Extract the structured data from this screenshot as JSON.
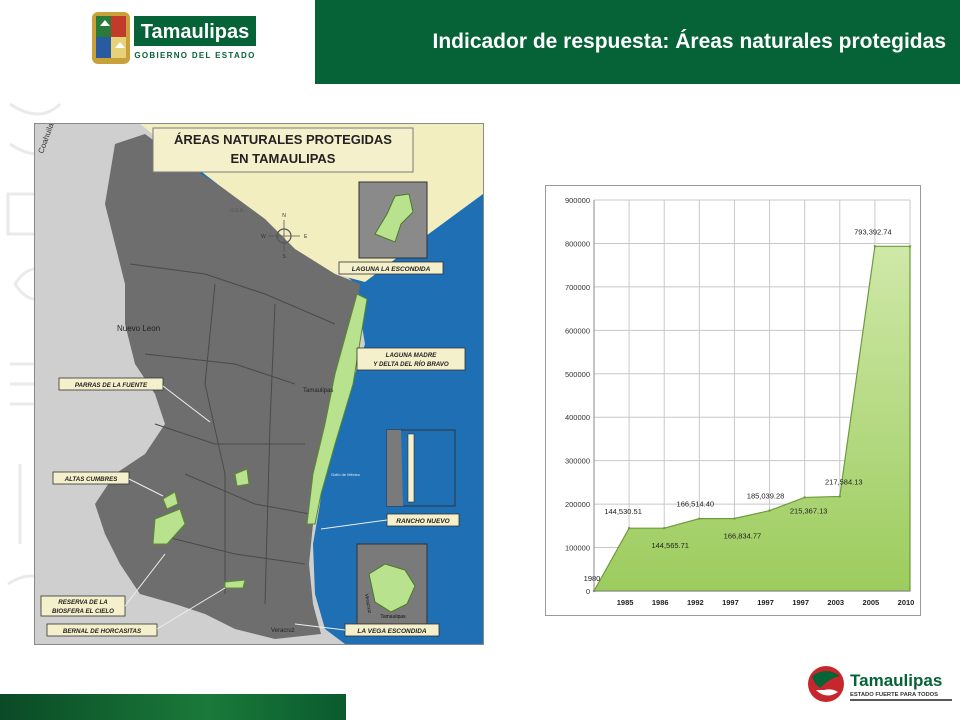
{
  "header": {
    "logo_name": "Tamaulipas",
    "logo_subtitle": "GOBIERNO DEL ESTADO",
    "title": "Indicador de respuesta: Áreas naturales protegidas"
  },
  "map": {
    "title_line1": "ÁREAS NATURALES PROTEGIDAS",
    "title_line2": "EN TAMAULIPAS",
    "labels": {
      "coahuila": "Coahuila",
      "usa": "U.S.A.",
      "nuevo_leon": "Nuevo Leon",
      "tamaulipas": "Tamaulipas",
      "golfo": "Golfo de México",
      "veracruz": "Veracruz",
      "compass_n": "N",
      "compass_s": "S",
      "compass_e": "E",
      "compass_w": "W",
      "inset_tamaulipas": "Tamaulipas",
      "inset_veracruz": "Veracruz"
    },
    "areas": {
      "laguna_escondida": "LAGUNA LA ESCONDIDA",
      "laguna_madre_1": "LAGUNA MADRE",
      "laguna_madre_2": "Y DELTA DEL RÍO BRAVO",
      "parras": "PARRAS DE LA FUENTE",
      "altas_cumbres": "ALTAS CUMBRES",
      "rancho_nuevo": "RANCHO NUEVO",
      "reserva_1": "RESERVA DE LA",
      "reserva_2": "BIOSFERA EL CIELO",
      "bernal": "BERNAL DE HORCASITAS",
      "vega": "LA VEGA ESCONDIDA"
    },
    "colors": {
      "sea": "#1e6fb3",
      "land": "#6e6e6e",
      "usa": "#f3eec0",
      "protected": "#b9e28f"
    }
  },
  "chart_data": {
    "type": "area",
    "categories": [
      "1980",
      "1985",
      "1986",
      "1992",
      "1997",
      "1997",
      "1997",
      "2003",
      "2005",
      "2010"
    ],
    "x_tick_labels": [
      "1985",
      "1986",
      "1992",
      "1997",
      "1997",
      "1997",
      "2003",
      "2005",
      "2010"
    ],
    "values": [
      0,
      144530.51,
      144565.71,
      166514.4,
      166834.77,
      185039.28,
      215367.13,
      217584.13,
      793392.74,
      793392.74
    ],
    "data_labels": [
      {
        "index": 0,
        "text": "1980"
      },
      {
        "index": 1,
        "text": "144,530.51"
      },
      {
        "index": 2,
        "text": "144,565.71"
      },
      {
        "index": 3,
        "text": "166,514.40"
      },
      {
        "index": 4,
        "text": "166,834.77"
      },
      {
        "index": 5,
        "text": "185,039.28"
      },
      {
        "index": 6,
        "text": "215,367.13"
      },
      {
        "index": 7,
        "text": "217,584.13"
      },
      {
        "index": 8,
        "text": "793,392.74"
      }
    ],
    "y_ticks": [
      0,
      100000,
      200000,
      300000,
      400000,
      500000,
      600000,
      700000,
      800000,
      900000
    ],
    "ylim": [
      0,
      900000
    ],
    "grid": true,
    "colors": {
      "fill": "#9ccc5e",
      "fill_light": "#cfe8a8",
      "edge": "#6e9a3a",
      "grid": "#c8c8c8"
    }
  },
  "footer": {
    "logo_name": "Tamaulipas",
    "logo_slogan": "ESTADO FUERTE PARA TODOS"
  }
}
